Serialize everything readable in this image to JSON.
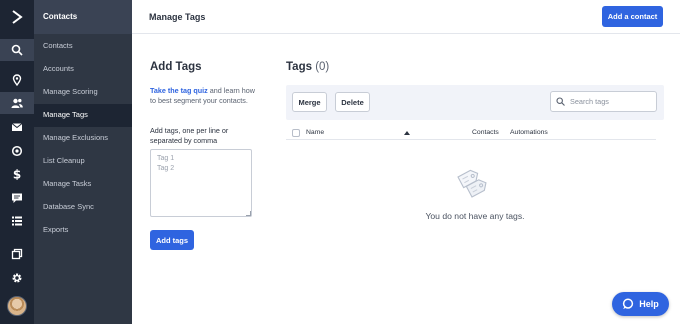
{
  "rail": {
    "icons": [
      "logo-chevron-icon",
      "search-icon",
      "location-pin-icon",
      "contacts-icon",
      "email-icon",
      "automations-icon",
      "deals-dollar-icon",
      "conversations-icon",
      "lists-icon",
      "pages-icon",
      "settings-gear-icon"
    ]
  },
  "subnav": {
    "header": "Contacts",
    "items": [
      {
        "label": "Contacts"
      },
      {
        "label": "Accounts"
      },
      {
        "label": "Manage Scoring"
      },
      {
        "label": "Manage Tags"
      },
      {
        "label": "Manage Exclusions"
      },
      {
        "label": "List Cleanup"
      },
      {
        "label": "Manage Tasks"
      },
      {
        "label": "Database Sync"
      },
      {
        "label": "Exports"
      }
    ]
  },
  "topbar": {
    "title": "Manage Tags",
    "add_button": "Add a contact"
  },
  "add_panel": {
    "title": "Add Tags",
    "quiz_link": "Take the tag quiz",
    "description_rest": " and learn how to best segment your contacts.",
    "input_label": "Add tags, one per line or separated by comma",
    "textarea_value": "",
    "textarea_placeholder": "Tag 1\nTag 2",
    "submit_button": "Add tags"
  },
  "tags_panel": {
    "title": "Tags",
    "count": "(0)",
    "merge_button": "Merge",
    "delete_button": "Delete",
    "search_placeholder": "Search tags",
    "search_value": "",
    "columns": [
      "Name",
      "Contacts",
      "Automations"
    ],
    "empty_message": "You do not have any tags."
  },
  "help_button": "Help",
  "colors": {
    "accent": "#2f64e0",
    "rail_bg": "#1d2533",
    "subnav_bg": "#2f3744",
    "toolbar_bg": "#f1f3f9"
  }
}
